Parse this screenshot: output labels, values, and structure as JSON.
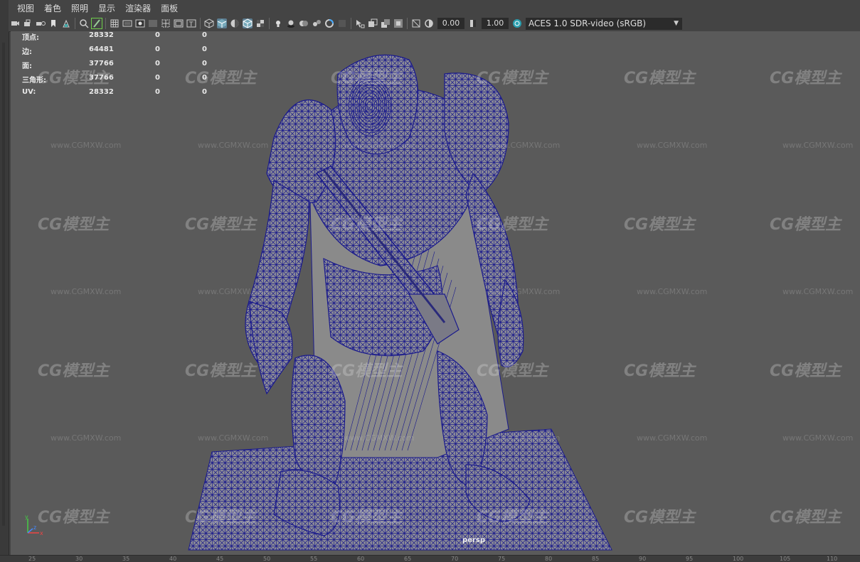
{
  "menu": [
    "视图",
    "着色",
    "照明",
    "显示",
    "渲染器",
    "面板"
  ],
  "toolbar": {
    "icons": [
      "camera-icon",
      "camera-lock-icon",
      "camera-attr-icon",
      "bookmark-icon",
      "image-plane-icon",
      "2d-pan-icon",
      "grease-pencil-icon",
      "grid-icon",
      "film-gate-icon",
      "resolution-gate-icon",
      "gate-mask-icon",
      "field-chart-icon",
      "safe-action-icon",
      "safe-title-icon",
      "wireframe-icon",
      "smooth-shade-icon",
      "default-material-icon",
      "wireframe-on-shaded-icon",
      "textured-icon",
      "use-all-lights-icon",
      "shadows-icon",
      "screen-space-ao-icon",
      "motion-blur-icon",
      "multisample-aa-icon",
      "depth-of-field-icon",
      "isolate-select-icon",
      "xray-icon",
      "xray-joints-icon",
      "xray-components-icon",
      "backface-cull-icon",
      "exposure-icon",
      "gamma-icon",
      "color-management-icon"
    ],
    "exposure_value": "0.00",
    "gamma_value": "1.00",
    "color_space": "ACES 1.0 SDR-video (sRGB)"
  },
  "hud": {
    "rows": [
      {
        "label": "顶点:",
        "total": "28332",
        "selected": "0",
        "highlighted": "0"
      },
      {
        "label": "边:",
        "total": "64481",
        "selected": "0",
        "highlighted": "0"
      },
      {
        "label": "面:",
        "total": "37766",
        "selected": "0",
        "highlighted": "0"
      },
      {
        "label": "三角形:",
        "total": "37766",
        "selected": "0",
        "highlighted": "0"
      },
      {
        "label": "UV:",
        "total": "28332",
        "selected": "0",
        "highlighted": "0"
      }
    ]
  },
  "watermark": {
    "logo": "CG模型主",
    "url": "www.CGMXW.com"
  },
  "camera_name": "persp",
  "axis": {
    "y": "y",
    "x": "x",
    "z": "z"
  },
  "ruler_ticks": [
    "25",
    "30",
    "35",
    "40",
    "45",
    "50",
    "55",
    "60",
    "65",
    "70",
    "75",
    "80",
    "85",
    "90",
    "95",
    "100",
    "105",
    "110"
  ],
  "colors": {
    "wire": "#1a1a8c",
    "viewport": "#5a5a5a",
    "active": "#5d7f93"
  }
}
